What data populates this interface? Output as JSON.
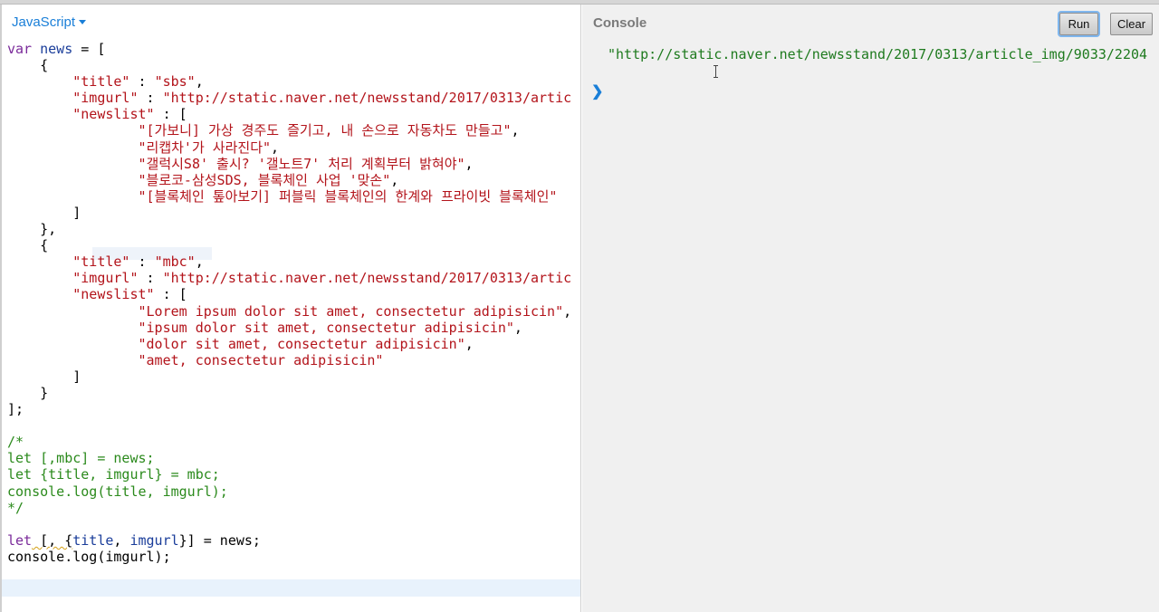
{
  "editor": {
    "language_label": "JavaScript",
    "code_lines": [
      [
        [
          "k",
          "var"
        ],
        [
          "p",
          " "
        ],
        [
          "v",
          "news"
        ],
        [
          "p",
          " = ["
        ]
      ],
      [
        [
          "p",
          "    {"
        ]
      ],
      [
        [
          "p",
          "        "
        ],
        [
          "s",
          "\"title\""
        ],
        [
          "p",
          " : "
        ],
        [
          "s",
          "\"sbs\""
        ],
        [
          "p",
          ","
        ]
      ],
      [
        [
          "p",
          "        "
        ],
        [
          "s",
          "\"imgurl\""
        ],
        [
          "p",
          " : "
        ],
        [
          "s",
          "\"http://static.naver.net/newsstand/2017/0313/artic"
        ]
      ],
      [
        [
          "p",
          "        "
        ],
        [
          "s",
          "\"newslist\""
        ],
        [
          "p",
          " : ["
        ]
      ],
      [
        [
          "p",
          "                "
        ],
        [
          "s",
          "\"[가보니] 가상 경주도 즐기고, 내 손으로 자동차도 만들고\""
        ],
        [
          "p",
          ","
        ]
      ],
      [
        [
          "p",
          "                "
        ],
        [
          "s",
          "\"리캡차'가 사라진다\""
        ],
        [
          "p",
          ","
        ]
      ],
      [
        [
          "p",
          "                "
        ],
        [
          "s",
          "\"갤럭시S8' 출시? '갤노트7' 처리 계획부터 밝혀야\""
        ],
        [
          "p",
          ","
        ]
      ],
      [
        [
          "p",
          "                "
        ],
        [
          "s",
          "\"블로코-삼성SDS, 블록체인 사업 '맞손\""
        ],
        [
          "p",
          ","
        ]
      ],
      [
        [
          "p",
          "                "
        ],
        [
          "s",
          "\"[블록체인 톺아보기] 퍼블릭 블록체인의 한계와 프라이빗 블록체인\""
        ]
      ],
      [
        [
          "p",
          "        ]"
        ]
      ],
      [
        [
          "p",
          "    },"
        ]
      ],
      [
        [
          "p",
          "    {"
        ]
      ],
      [
        [
          "p",
          "        "
        ],
        [
          "s",
          "\"title\""
        ],
        [
          "p",
          " : "
        ],
        [
          "s",
          "\"mbc\""
        ],
        [
          "p",
          ","
        ]
      ],
      [
        [
          "p",
          "        "
        ],
        [
          "s",
          "\"imgurl\""
        ],
        [
          "p",
          " : "
        ],
        [
          "s",
          "\"http://static.naver.net/newsstand/2017/0313/artic"
        ]
      ],
      [
        [
          "p",
          "        "
        ],
        [
          "s",
          "\"newslist\""
        ],
        [
          "p",
          " : ["
        ]
      ],
      [
        [
          "p",
          "                "
        ],
        [
          "s",
          "\"Lorem ipsum dolor sit amet, consectetur adipisicin\""
        ],
        [
          "p",
          ","
        ]
      ],
      [
        [
          "p",
          "                "
        ],
        [
          "s",
          "\"ipsum dolor sit amet, consectetur adipisicin\""
        ],
        [
          "p",
          ","
        ]
      ],
      [
        [
          "p",
          "                "
        ],
        [
          "s",
          "\"dolor sit amet, consectetur adipisicin\""
        ],
        [
          "p",
          ","
        ]
      ],
      [
        [
          "p",
          "                "
        ],
        [
          "s",
          "\"amet, consectetur adipisicin\""
        ]
      ],
      [
        [
          "p",
          "        ]"
        ]
      ],
      [
        [
          "p",
          "    }"
        ]
      ],
      [
        [
          "p",
          "];"
        ]
      ],
      [
        [
          "p",
          ""
        ]
      ],
      [
        [
          "c",
          "/*"
        ]
      ],
      [
        [
          "c",
          "let [,mbc] = news;"
        ]
      ],
      [
        [
          "c",
          "let {title, imgurl} = mbc;"
        ]
      ],
      [
        [
          "c",
          "console.log(title, imgurl);"
        ]
      ],
      [
        [
          "c",
          "*/"
        ]
      ],
      [
        [
          "p",
          ""
        ]
      ],
      [
        [
          "k",
          "let"
        ],
        [
          "p",
          " [, {"
        ],
        [
          "v",
          "title"
        ],
        [
          "p",
          ", "
        ],
        [
          "v",
          "imgurl"
        ],
        [
          "p",
          "}] = news;"
        ]
      ],
      [
        [
          "p",
          "console.log(imgurl);"
        ]
      ]
    ]
  },
  "console": {
    "title": "Console",
    "run_label": "Run",
    "clear_label": "Clear",
    "output_text": "\"http://static.naver.net/newsstand/2017/0313/article_img/9033/2204",
    "prompt_icon": "chevron-right-icon"
  },
  "colors": {
    "keyword": "#7a2a9a",
    "variable": "#1a3d9a",
    "string": "#b3141b",
    "comment": "#2b8a1c",
    "console_output": "#1e7a1e",
    "accent": "#1a7fd8"
  }
}
